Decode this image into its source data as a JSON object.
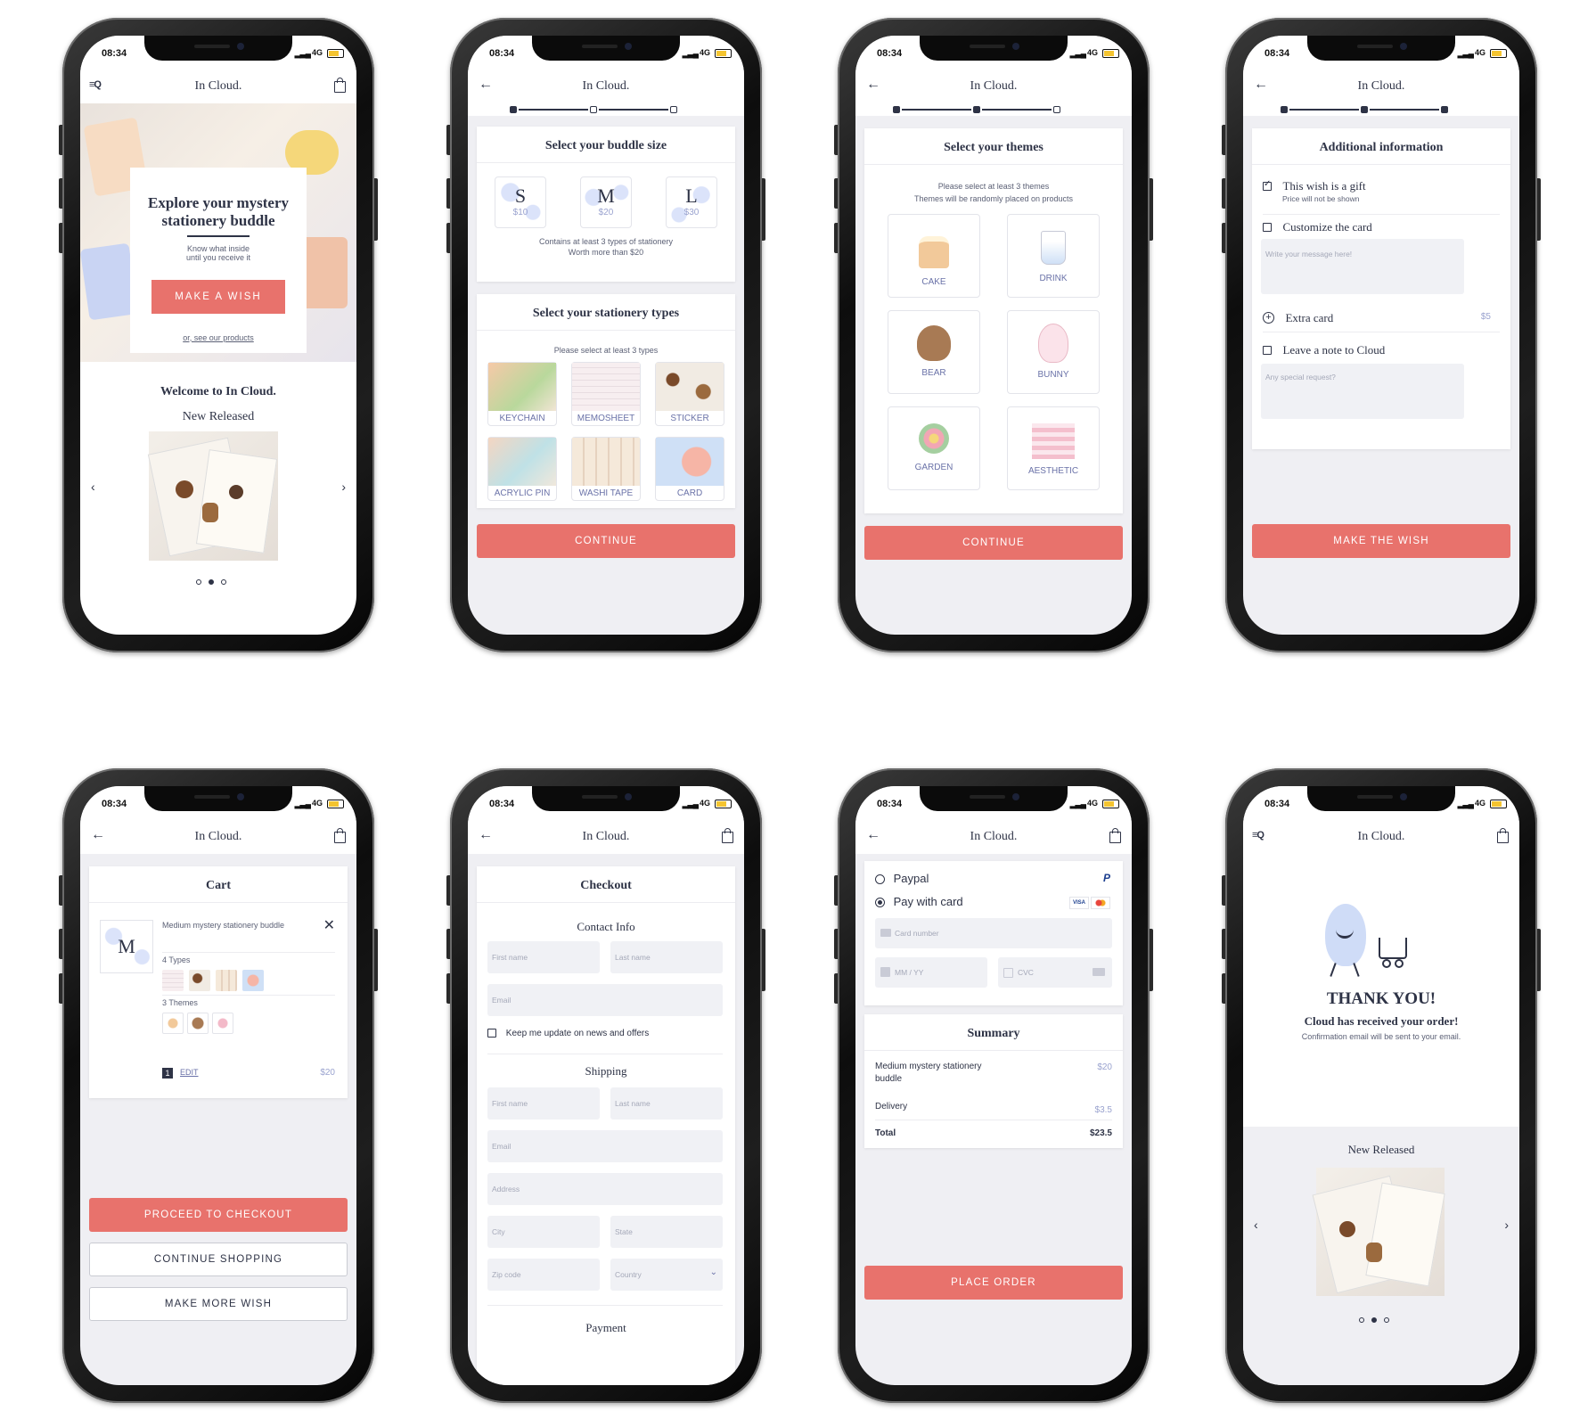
{
  "common": {
    "time": "08:34",
    "network": "4G",
    "brand": "In Cloud."
  },
  "s1": {
    "hero_title": "Explore your mystery stationery buddle",
    "hero_sub1": "Know what inside",
    "hero_sub2": "until you receive it",
    "cta": "MAKE A WISH",
    "link": "or, see our products",
    "welcome": "Welcome to In Cloud.",
    "new_released": "New Released"
  },
  "s2": {
    "size_title": "Select your buddle size",
    "sizes": [
      {
        "letter": "S",
        "price": "$10"
      },
      {
        "letter": "M",
        "price": "$20"
      },
      {
        "letter": "L",
        "price": "$30"
      }
    ],
    "size_note1": "Contains at least 3 types of stationery",
    "size_note2": "Worth more than $20",
    "types_title": "Select your stationery types",
    "types_note": "Please select at least 3 types",
    "types": [
      "KEYCHAIN",
      "MEMOSHEET",
      "STICKER",
      "ACRYLIC PIN",
      "WASHI TAPE",
      "CARD"
    ],
    "cta": "CONTINUE"
  },
  "s3": {
    "title": "Select your themes",
    "note1": "Please select at least 3 themes",
    "note2": "Themes will be randomly placed on products",
    "themes": [
      "CAKE",
      "DRINK",
      "BEAR",
      "BUNNY",
      "GARDEN",
      "AESTHETIC"
    ],
    "cta": "CONTINUE"
  },
  "s4": {
    "title": "Additional information",
    "gift": "This wish is a gift",
    "gift_note": "Price will not be shown",
    "customize": "Customize the card",
    "message_ph": "Write your message here!",
    "extra": "Extra card",
    "extra_price": "$5",
    "note": "Leave a note to Cloud",
    "request_ph": "Any special request?",
    "cta": "MAKE THE WISH"
  },
  "s5": {
    "title": "Cart",
    "item_letter": "M",
    "item_name": "Medium mystery stationery buddle",
    "types_label": "4  Types",
    "themes_label": "3  Themes",
    "qty": "1",
    "edit": "EDIT",
    "price": "$20",
    "btn_checkout": "PROCEED TO CHECKOUT",
    "btn_continue": "CONTINUE SHOPPING",
    "btn_more": "MAKE MORE WISH"
  },
  "s6": {
    "title": "Checkout",
    "contact": "Contact Info",
    "first": "First name",
    "last": "Last name",
    "email": "Email",
    "keep": "Keep me update on news and offers",
    "shipping": "Shipping",
    "address": "Address",
    "city": "City",
    "state": "State",
    "zip": "Zip code",
    "country": "Country",
    "payment": "Payment"
  },
  "s7": {
    "paypal": "Paypal",
    "card": "Pay with card",
    "card_number": "Card number",
    "expiry": "MM / YY",
    "cvc": "CVC",
    "summary": "Summary",
    "item": "Medium mystery stationery buddle",
    "item_price": "$20",
    "delivery": "Delivery",
    "delivery_price": "$3.5",
    "total": "Total",
    "total_price": "$23.5",
    "cta": "PLACE ORDER"
  },
  "s8": {
    "thanks": "THANK YOU!",
    "received": "Cloud has received your order!",
    "confirm": "Confirmation email will be sent to your email.",
    "new_released": "New Released"
  },
  "colors": {
    "accent": "#e8726c",
    "ink": "#2e3346",
    "muted": "#6a72a8",
    "bg": "#efeff3"
  }
}
